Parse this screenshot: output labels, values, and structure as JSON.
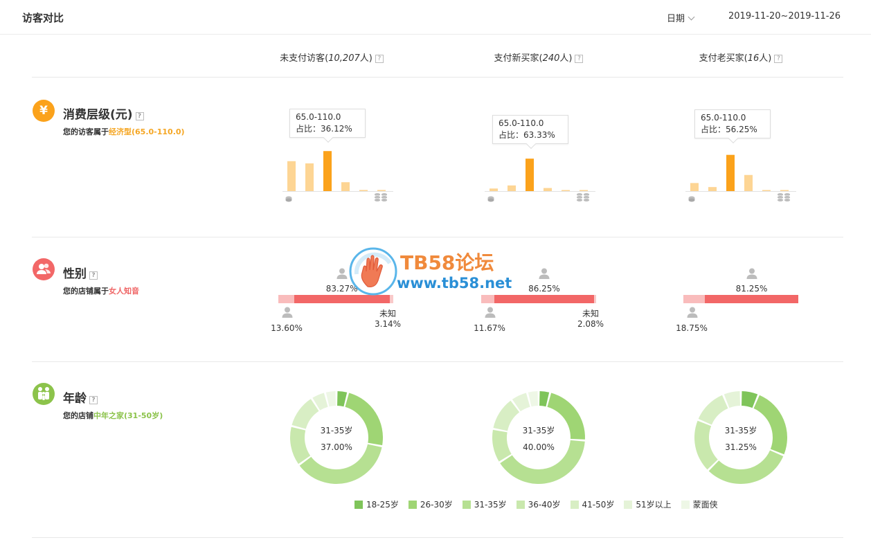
{
  "header": {
    "title": "访客对比",
    "date_label": "日期",
    "date_range": "2019-11-20~2019-11-26"
  },
  "columns": [
    {
      "label": "未支付访客(",
      "count": "10,207",
      "unit": "人)"
    },
    {
      "label": "支付新买家(",
      "count": "240",
      "unit": "人)"
    },
    {
      "label": "支付老买家(",
      "count": "16",
      "unit": "人)"
    }
  ],
  "help_glyph": "?",
  "consumption": {
    "title": "消费层级(元)",
    "subtitle_prefix": "您的访客属于",
    "subtitle_value": "经济型(65.0-110.0)",
    "icon": "yuan-icon",
    "icon_glyph": "¥",
    "color_main": "#fba21b",
    "color_light": "#fdd594",
    "charts": [
      {
        "tooltip_range": "65.0-110.0",
        "tooltip_label": "占比：36.12%",
        "values": [
          27,
          25,
          36.12,
          8,
          1,
          1
        ],
        "highlight": 2
      },
      {
        "tooltip_range": "65.0-110.0",
        "tooltip_label": "占比：63.33%",
        "values": [
          5,
          11,
          63.33,
          6,
          1,
          1
        ],
        "highlight": 2
      },
      {
        "tooltip_range": "65.0-110.0",
        "tooltip_label": "占比：56.25%",
        "values": [
          12.5,
          6.25,
          56.25,
          25,
          1,
          1
        ],
        "highlight": 2
      }
    ]
  },
  "gender": {
    "title": "性别",
    "subtitle_prefix": "您的店铺属于",
    "subtitle_value": "女人知音",
    "icon": "people-icon",
    "color_female": "#f26767",
    "color_male": "#f9bcbc",
    "unknown_label": "未知",
    "columns": [
      {
        "female": "83.27%",
        "male": "13.60%",
        "unknown": "3.14%",
        "female_v": 83.27,
        "male_v": 13.6,
        "unknown_v": 3.14
      },
      {
        "female": "86.25%",
        "male": "11.67%",
        "unknown": "2.08%",
        "female_v": 86.25,
        "male_v": 11.67,
        "unknown_v": 2.08
      },
      {
        "female": "81.25%",
        "male": "18.75%",
        "unknown": "",
        "female_v": 81.25,
        "male_v": 18.75,
        "unknown_v": 0
      }
    ]
  },
  "age": {
    "title": "年龄",
    "subtitle_prefix": "您的店铺",
    "subtitle_value": "中年之家(31-50岁)",
    "icon": "family-icon",
    "legend": [
      {
        "label": "18-25岁",
        "color": "#7fc45a"
      },
      {
        "label": "26-30岁",
        "color": "#9fd574"
      },
      {
        "label": "31-35岁",
        "color": "#b6e092"
      },
      {
        "label": "36-40岁",
        "color": "#c9e8ad"
      },
      {
        "label": "41-50岁",
        "color": "#d8eec4"
      },
      {
        "label": "51岁以上",
        "color": "#e5f3d8"
      },
      {
        "label": "蒙面侠",
        "color": "#eef7e6"
      }
    ],
    "donuts": [
      {
        "center_label": "31-35岁",
        "center_value": "37.00%",
        "values": [
          4,
          24,
          37,
          14,
          12,
          5,
          4
        ]
      },
      {
        "center_label": "31-35岁",
        "center_value": "40.00%",
        "values": [
          4,
          22,
          40,
          12,
          12,
          6,
          4
        ]
      },
      {
        "center_label": "31-35岁",
        "center_value": "31.25%",
        "values": [
          6.25,
          25,
          31.25,
          18.75,
          12.5,
          6.25,
          0
        ]
      }
    ]
  },
  "watermark": {
    "line1": "TB58论坛",
    "line2": "www.tb58.net"
  }
}
